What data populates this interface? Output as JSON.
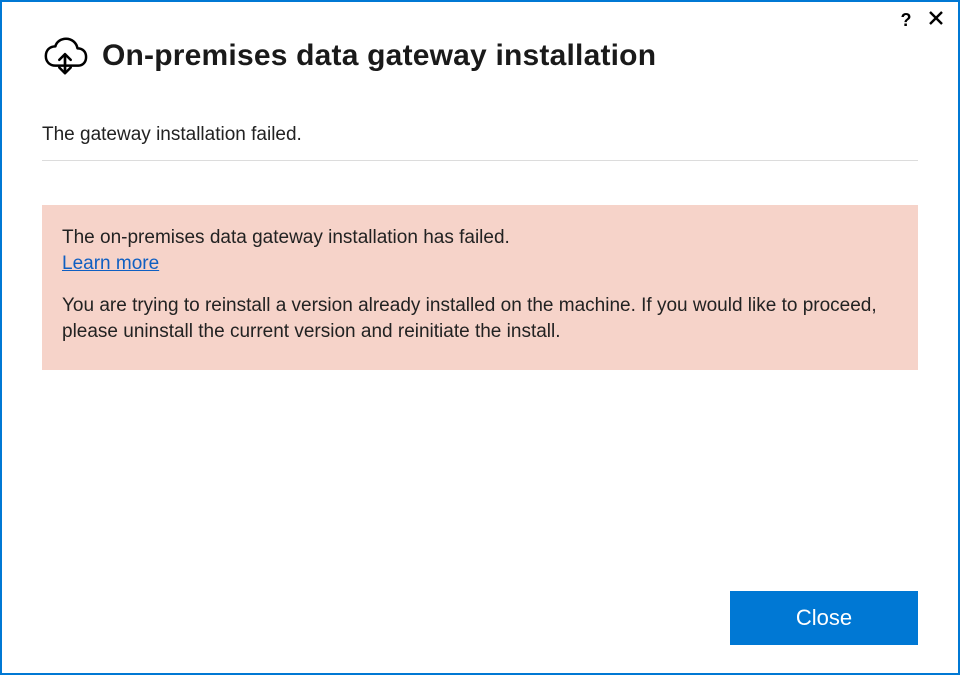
{
  "window": {
    "title": "On-premises data gateway installation"
  },
  "status": {
    "message": "The gateway installation failed."
  },
  "error": {
    "title": "The on-premises data gateway installation has failed.",
    "learn_more_label": "Learn more",
    "detail": "You are trying to reinstall a version already installed on the machine. If you would like to proceed, please uninstall the current version and reinitiate the install."
  },
  "footer": {
    "close_label": "Close"
  }
}
